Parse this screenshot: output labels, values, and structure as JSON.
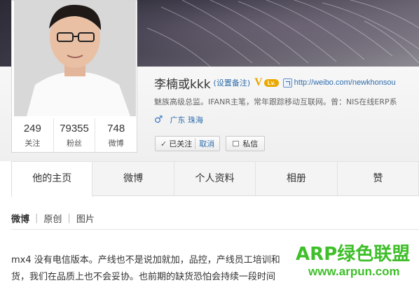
{
  "profile": {
    "name": "李楠或kkk",
    "set_note": "(设置备注)",
    "verified_badge": "V",
    "level_badge": "Lv.",
    "blog_url": "http://weibo.com/newkhonsou",
    "intro": "魅族高级总监。IFANR主笔，常年跟踪移动互联网。曾：NIS在线ERP系",
    "gender_icon": "male-icon",
    "location": "广东 珠海"
  },
  "stats": [
    {
      "value": "249",
      "label": "关注"
    },
    {
      "value": "79355",
      "label": "粉丝"
    },
    {
      "value": "748",
      "label": "微博"
    }
  ],
  "buttons": {
    "followed": "已关注",
    "cancel": "取消",
    "message": "私信"
  },
  "tabs": [
    "他的主页",
    "微博",
    "个人资料",
    "相册",
    "赞"
  ],
  "subnav": {
    "items": [
      "微博",
      "原创",
      "图片"
    ],
    "separator": "|"
  },
  "post": {
    "line1": "mx4 没有电信版本。产线也不是说加就加，品控，产线员工培训和",
    "line2": "货，我们在品质上也不会妥协。也前期的缺货恐怕会持续一段时间"
  },
  "watermark": {
    "title": "ARP绿色联盟",
    "url": "www.arpun.com"
  },
  "colors": {
    "link": "#2f6dad",
    "badge": "#e9a900",
    "watermark": "#3fbf2a"
  }
}
